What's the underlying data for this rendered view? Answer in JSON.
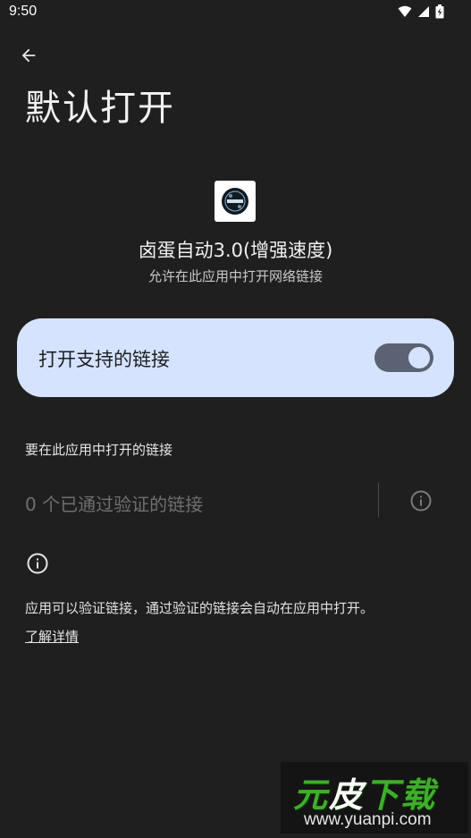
{
  "status_bar": {
    "time": "9:50",
    "icons": [
      "wifi-icon",
      "signal-icon",
      "battery-icon"
    ]
  },
  "header": {
    "back_icon": "arrow-left-icon",
    "title": "默认打开"
  },
  "app": {
    "name": "卤蛋自动3.0(增强速度)",
    "subtitle": "允许在此应用中打开网络链接"
  },
  "toggle_card": {
    "label": "打开支持的链接",
    "enabled": true
  },
  "links_section": {
    "header": "要在此应用中打开的链接",
    "verified_links_text": "0 个已通过验证的链接",
    "info_icon": "info-icon"
  },
  "footer": {
    "info_icon": "info-icon",
    "description": "应用可以验证链接，通过验证的链接会自动在应用中打开。",
    "learn_more": "了解详情"
  },
  "watermark": {
    "brand_part1": "元",
    "brand_part2": "皮",
    "brand_part3": "下载",
    "url": "www.yuanpi.com"
  },
  "colors": {
    "background": "#1f1f1f",
    "card": "#d6e3ff",
    "switch_track": "#5a6273",
    "muted_text": "#6f6f6f"
  }
}
